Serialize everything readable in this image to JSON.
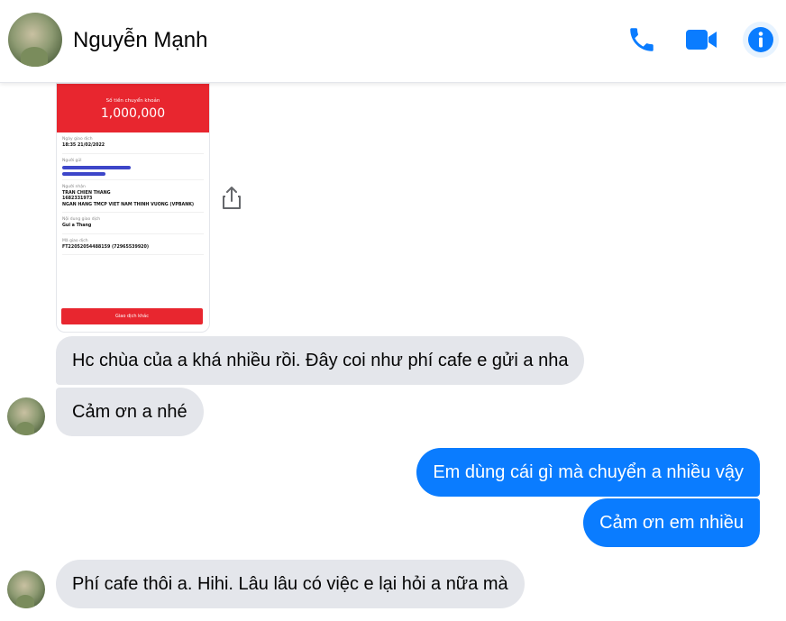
{
  "header": {
    "contact_name": "Nguyễn Mạnh",
    "icons": [
      "phone-icon",
      "video-camera-icon",
      "info-icon"
    ],
    "accent_color": "#0a7cff"
  },
  "receipt": {
    "amount_label": "Số tiền chuyển khoản",
    "amount": "1,000,000",
    "date_label": "Ngày giao dịch",
    "date_value": "18:35 21/02/2022",
    "sender_label": "Người gửi",
    "recipient_label": "Người nhận",
    "recipient_name": "TRAN CHIEN THANG",
    "recipient_account": "1682331973",
    "recipient_bank": "NGAN HANG TMCP VIET NAM THINH VUONG (VPBANK)",
    "content_label": "Nội dung giao dịch",
    "content_value": "Gui a Thang",
    "code_label": "Mã giao dịch",
    "code_value": "FT22052054488159 (72965539920)",
    "button_label": "Giao dịch khác"
  },
  "messages": [
    {
      "direction": "incoming",
      "text": "Hc chùa của a khá nhiều rồi. Đây coi như phí cafe e gửi a nha"
    },
    {
      "direction": "incoming",
      "text": "Cảm ơn a nhé"
    },
    {
      "direction": "outgoing",
      "text": "Em dùng cái gì mà chuyển a nhiều vậy"
    },
    {
      "direction": "outgoing",
      "text": "Cảm ơn em nhiều"
    },
    {
      "direction": "incoming",
      "text": "Phí cafe thôi a. Hihi. Lâu lâu có việc e lại hỏi a nữa mà"
    }
  ]
}
